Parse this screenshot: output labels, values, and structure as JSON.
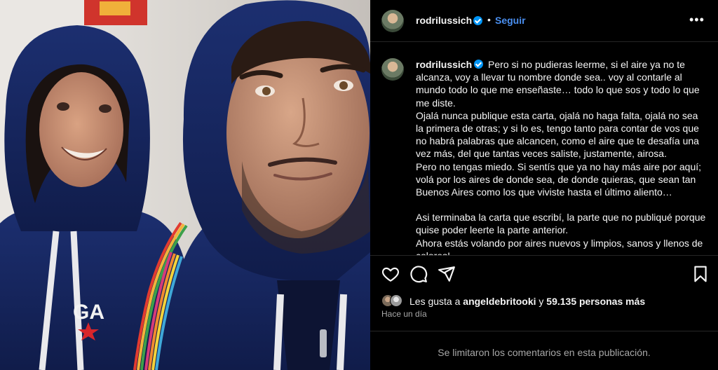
{
  "post": {
    "username": "rodrilussich",
    "verified": true,
    "separator": "•",
    "follow_label": "Seguir",
    "more_label": "•••",
    "caption_paragraphs": [
      "Pero si no pudieras leerme, si el aire ya no te alcanza, voy a llevar tu nombre donde sea.. voy al contarle al mundo todo lo que me enseñaste… todo lo que sos y todo lo que me diste.",
      "Ojalá nunca publique esta carta, ojalá no haga falta, ojalá no sea la primera de otras; y si lo es, tengo tanto para contar de vos que no habrá palabras que alcancen, como el aire que te desafía una vez más, del que tantas veces saliste, justamente, airosa.",
      "Pero no tengas miedo. Si sentís que ya no hay más aire por aquí; volá por los aires de donde sea, de donde quieras, que sean tan Buenos Aires como los que viviste hasta el último aliento…",
      "Asi terminaba la carta que escribí, la parte que no publiqué porque quise poder leerte la parte anterior.",
      "Ahora estás volando por aires nuevos y limpios, sanos y llenos de colores!"
    ],
    "likes": {
      "prefix": "Les gusta a",
      "user": "angeldebritooki",
      "connector": "y",
      "others": "59.135 personas más"
    },
    "time_ago": "Hace un día",
    "comments_disabled": "Se limitaron los comentarios en esta publicación.",
    "photo": {
      "hoodie_text": "GA"
    },
    "icons": {
      "like": "heart-icon",
      "comment": "comment-icon",
      "share": "share-icon",
      "save": "bookmark-icon"
    },
    "colors": {
      "accent": "#0095f6",
      "follow": "#4a8ff0",
      "background": "#000000",
      "muted": "#a8a8a8"
    }
  }
}
